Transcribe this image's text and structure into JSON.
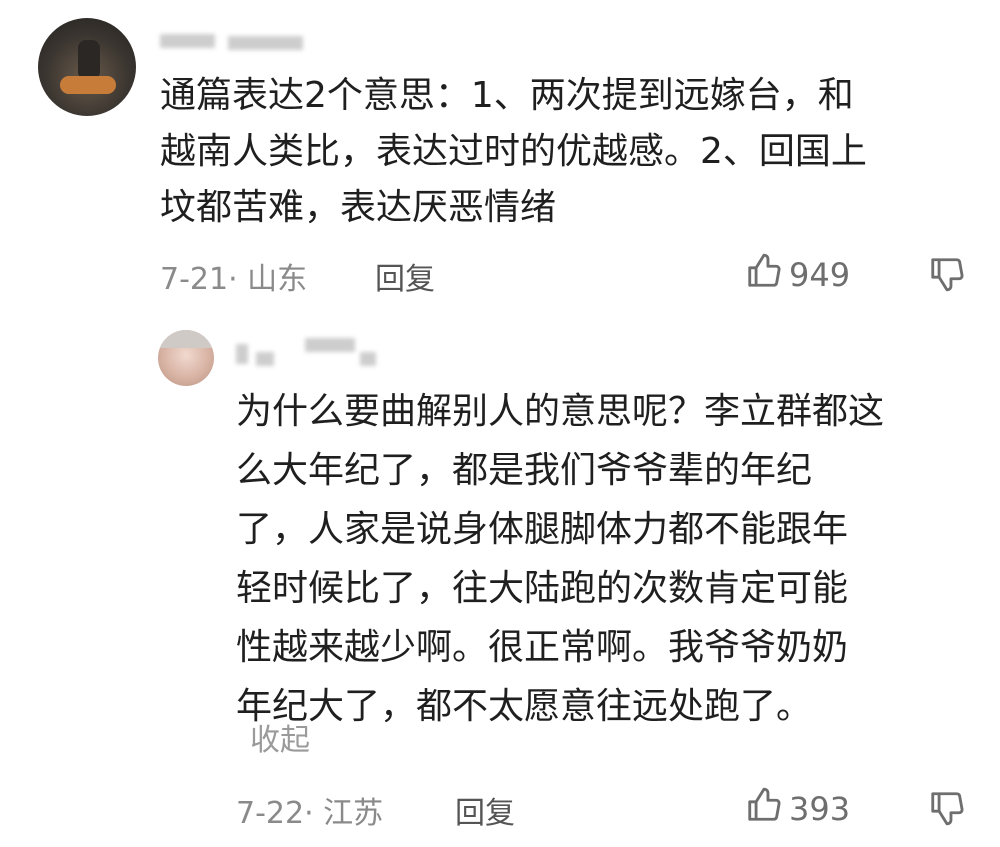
{
  "comment": {
    "text_lines": [
      "通篇表达2个意思：1、两次提到远嫁台，和",
      "越南人类比，表达过时的优越感。2、回国上",
      "坟都苦难，表达厌恶情绪"
    ],
    "meta": "7-21· 山东",
    "reply_label": "回复",
    "likes": "949"
  },
  "reply": {
    "text_lines": [
      "为什么要曲解别人的意思呢？李立群都这",
      "么大年纪了，都是我们爷爷辈的年纪",
      "了，人家是说身体腿脚体力都不能跟年",
      "轻时候比了，往大陆跑的次数肯定可能",
      "性越来越少啊。很正常啊。我爷爷奶奶",
      "年纪大了，都不太愿意往远处跑了。"
    ],
    "collapse_label": "收起",
    "meta": "7-22· 江苏",
    "reply_label": "回复",
    "likes": "393"
  },
  "icons": {
    "like": "thumbs-up-icon",
    "dislike": "thumbs-down-icon"
  },
  "colors": {
    "text": "#1f1f1f",
    "meta": "#8a8a8a",
    "icon": "#6e6e6e"
  }
}
